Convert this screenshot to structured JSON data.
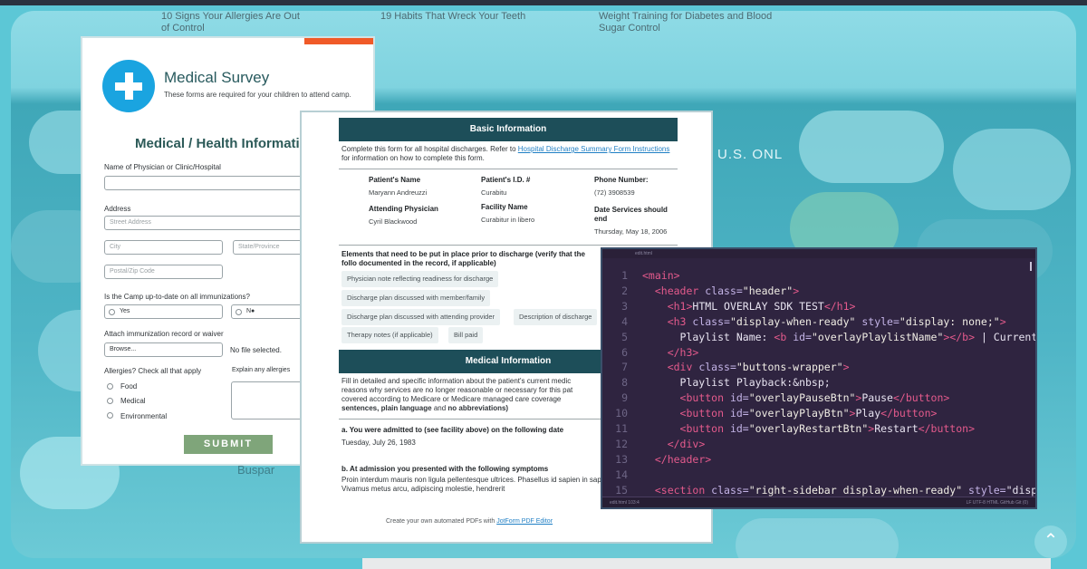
{
  "background": {
    "articles": [
      {
        "title": "10 Signs Your Allergies Are Out of Control"
      },
      {
        "title": "19 Habits That Wreck Your Teeth"
      },
      {
        "title": "Weight Training for Diabetes and Blood Sugar Control"
      }
    ],
    "ad_label": "U.S. ONL",
    "drug_label": "Buspar",
    "scroll_top_icon": "chevron-up-icon",
    "colors": {
      "frame": "#5cc7d6",
      "topbar": "#2a3340"
    }
  },
  "survey_form": {
    "title": "Medical Survey",
    "subtitle": "These forms are required for your children to attend camp.",
    "logo_icon": "medical-cross-icon",
    "section_title": "Medical / Health Informati",
    "physician_label": "Name of Physician or Clinic/Hospital",
    "address_label": "Address",
    "street_placeholder": "Street Address",
    "city_placeholder": "City",
    "state_placeholder": "State/Province",
    "zip_placeholder": "Postal/Zip Code",
    "immunization_question": "Is the Camp up-to-date on all immunizations?",
    "immunization_options": [
      "Yes",
      "N●"
    ],
    "attach_label": "Attach immunization record or waiver",
    "browse_label": "Browse...",
    "file_status": "No file selected.",
    "allergies_label": "Allergies? Check all that apply",
    "allergy_options": [
      "Food",
      "Medical",
      "Environmental"
    ],
    "explain_label": "Explain any allergies",
    "submit_label": "SUBMIT",
    "accent_color": "#f05a28"
  },
  "discharge_form": {
    "basic_header": "Basic Information",
    "intro_text": "Complete this form for all hospital discharges. Refer to",
    "intro_link": "Hospital Discharge Summary Form Instructions",
    "intro_rest": "for information on how to complete this form.",
    "fields": [
      {
        "label": "Patient's Name",
        "value": "Maryann Andreuzzi"
      },
      {
        "label": "Patient's I.D. #",
        "value": "Curabitu"
      },
      {
        "label": "Phone Number:",
        "value": "(72) 3908539"
      },
      {
        "label": "Attending Physician",
        "value": "Cyril Blackwood"
      },
      {
        "label": "Facility Name",
        "value": "Curabitur in libero"
      },
      {
        "label": "Date Services should end",
        "value": "Thursday, May 18, 2006"
      }
    ],
    "elements_text": "Elements that need to be put in place prior to discharge (verify that the follo documented in the record, if applicable)",
    "chips": [
      "Physician note reflecting readiness for discharge",
      "Discharge plan discussed with member/family",
      "Discharge plan discussed with attending provider",
      "Description of discharge",
      "Therapy notes (if applicable)",
      "Bill paid"
    ],
    "medical_header": "Medical Information",
    "medical_text_1": "Fill in detailed and specific information about the patient's current medic",
    "medical_text_2": "reasons why services are no longer reasonable or necessary for this pat",
    "medical_text_3": "covered according to Medicare or Medicare managed care coverage",
    "medical_text_4_a": "sentences, plain language",
    "medical_text_4_b": "and",
    "medical_text_4_c": "no abbreviations)",
    "q_a": "a. You were admitted to (see facility above) on the following date",
    "q_a_value": "Tuesday, July 26, 1983",
    "q_b": "b. At admission you presented with the following symptoms",
    "q_b_value_1": "Proin interdum mauris non ligula pellentesque ultrices. Phasellus id sapien in sap",
    "q_b_value_2": "Vivamus metus arcu, adipiscing molestie, hendrerit",
    "footer_text": "Create your own automated PDFs with",
    "footer_link": "JotForm PDF Editor"
  },
  "code_editor": {
    "tab_label": "edit.html",
    "status_left": "edit.html   103:4",
    "status_right": "LF   UTF-8   HTML   GitHub   Git (0)",
    "line_numbers": [
      "1",
      "2",
      "3",
      "4",
      "5",
      "6",
      "7",
      "8",
      "9",
      "10",
      "11",
      "12",
      "13",
      "14",
      "15"
    ],
    "lines": [
      "<main>",
      "  <header class=\"header\">",
      "    <h1>HTML OVERLAY SDK TEST</h1>",
      "    <h3 class=\"display-when-ready\" style=\"display: none;\">",
      "      Playlist Name: <b id=\"overlayPlaylistName\"></b> | Current",
      "    </h3>",
      "    <div class=\"buttons-wrapper\">",
      "      Playlist Playback:&nbsp;",
      "      <button id=\"overlayPauseBtn\">Pause</button>",
      "      <button id=\"overlayPlayBtn\">Play</button>",
      "      <button id=\"overlayRestartBtn\">Restart</button>",
      "    </div>",
      "  </header>",
      "",
      "  <section class=\"right-sidebar display-when-ready\" style=\"displ"
    ],
    "colors": {
      "bg": "#2f2440",
      "tag": "#e45a8c",
      "attr": "#c3b3e6"
    }
  }
}
